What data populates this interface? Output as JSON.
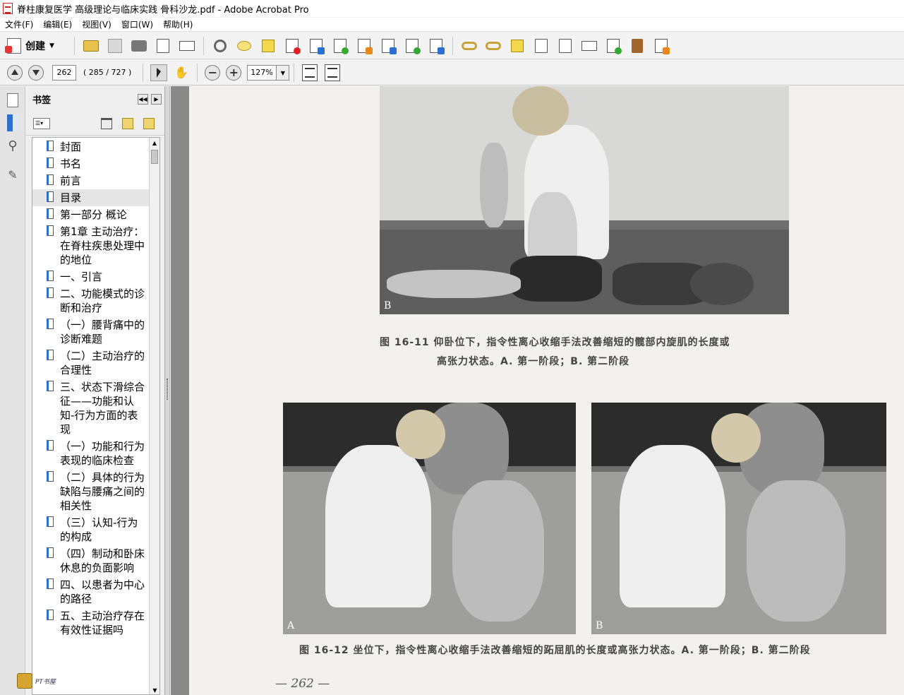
{
  "window": {
    "title": "脊柱康复医学 高级理论与临床实践 骨科沙龙.pdf - Adobe Acrobat Pro"
  },
  "menu": [
    "文件(F)",
    "编辑(E)",
    "视图(V)",
    "窗口(W)",
    "帮助(H)"
  ],
  "toolbar": {
    "create_label": "创建",
    "icons": [
      "open-folder-icon",
      "save-icon",
      "print-icon",
      "edit-icon",
      "email-icon",
      "settings-icon",
      "comment-icon",
      "highlight-icon",
      "delete-page-icon",
      "page-icon",
      "export-icon",
      "edit-pdf-icon",
      "forms-icon",
      "combine-icon",
      "attach-file-icon",
      "link-icon",
      "unlink-icon",
      "stamp-icon",
      "page-properties-icon",
      "blank-page-icon",
      "reading-icon",
      "sign-icon",
      "bookmark-book-icon",
      "clipboard-icon"
    ]
  },
  "navigation": {
    "page_number": "262",
    "page_count": "( 285 / 727 )",
    "zoom": "127%"
  },
  "bookmarks_panel": {
    "title": "书签",
    "items": [
      {
        "label": "封面",
        "selected": false
      },
      {
        "label": "书名",
        "selected": false
      },
      {
        "label": "前言",
        "selected": false
      },
      {
        "label": "目录",
        "selected": true
      },
      {
        "label": "第一部分  概论",
        "selected": false
      },
      {
        "label": "第1章  主动治疗：在脊柱疾患处理中的地位",
        "selected": false
      },
      {
        "label": "一、引言",
        "selected": false
      },
      {
        "label": "二、功能模式的诊断和治疗",
        "selected": false
      },
      {
        "label": "（一）腰背痛中的诊断难题",
        "selected": false
      },
      {
        "label": "（二）主动治疗的合理性",
        "selected": false
      },
      {
        "label": "三、状态下滑综合征——功能和认知-行为方面的表现",
        "selected": false
      },
      {
        "label": "（一）功能和行为表现的临床检查",
        "selected": false
      },
      {
        "label": "（二）具体的行为缺陷与腰痛之间的相关性",
        "selected": false
      },
      {
        "label": "（三）认知-行为的构成",
        "selected": false
      },
      {
        "label": "（四）制动和卧床休息的负面影响",
        "selected": false
      },
      {
        "label": "四、以患者为中心的路径",
        "selected": false
      },
      {
        "label": "五、主动治疗存在有效性证据吗",
        "selected": false
      }
    ]
  },
  "document": {
    "fig_11_letter": "B",
    "fig_11_caption_line1": "图 16-11   仰卧位下，指令性离心收缩手法改善缩短的髋部内旋肌的长度或",
    "fig_11_caption_line2": "高张力状态。A. 第一阶段；B. 第二阶段",
    "fig_12_letter_a": "A",
    "fig_12_letter_b": "B",
    "fig_12_caption": "图 16-12   坐位下，指令性离心收缩手法改善缩短的跖屈肌的长度或高张力状态。A. 第一阶段；B. 第二阶段",
    "page_footer": "—  262  —"
  },
  "watermark": {
    "text": "PT书屋"
  }
}
